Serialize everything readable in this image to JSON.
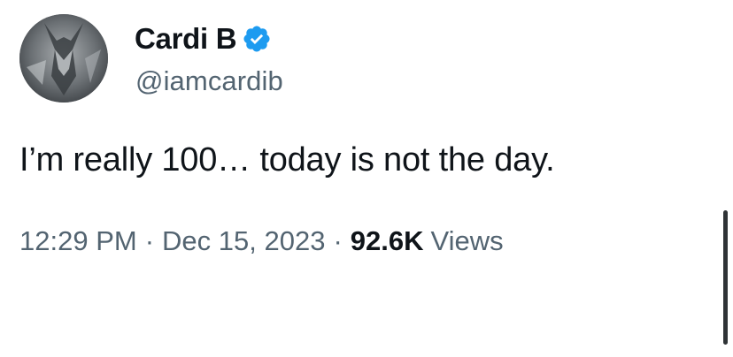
{
  "author": {
    "display_name": "Cardi B",
    "handle": "@iamcardib",
    "verified_icon": "verified-badge-icon",
    "verified_color": "#1d9bf0",
    "avatar_icon": "profile-photo"
  },
  "tweet": {
    "text": "I’m really 100… today is not the day.",
    "time": "12:29 PM",
    "separator": "·",
    "date": "Dec 15, 2023",
    "views_count": "92.6K",
    "views_label": "Views"
  },
  "colors": {
    "text_primary": "#0f1419",
    "text_secondary": "#536471",
    "background": "#ffffff"
  }
}
